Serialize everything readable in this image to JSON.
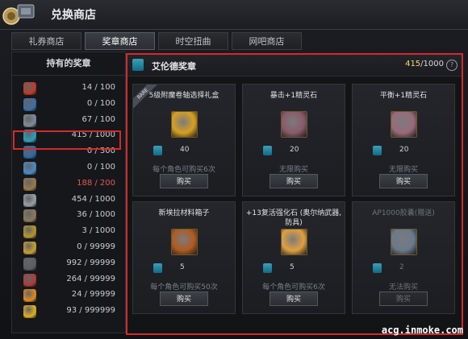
{
  "window": {
    "title": "兑换商店"
  },
  "tabs": [
    {
      "label": "礼券商店",
      "active": false
    },
    {
      "label": "奖章商店",
      "active": true
    },
    {
      "label": "时空扭曲",
      "active": false
    },
    {
      "label": "网吧商店",
      "active": false
    }
  ],
  "medals": {
    "header": "持有的奖章",
    "items": [
      {
        "count": "14 / 100",
        "icon": "red-orb-medal-icon",
        "color": "#c0392b"
      },
      {
        "count": "0 / 100",
        "icon": "blue-wing-medal-icon",
        "color": "#3b6fa8"
      },
      {
        "count": "67 / 100",
        "icon": "sword-medal-icon",
        "color": "#7f8c9a"
      },
      {
        "count": "415 / 1000",
        "icon": "elven-medal-icon",
        "color": "#2aa0c0",
        "selected": true
      },
      {
        "count": "0 / 300",
        "icon": "blue-shield-medal-icon",
        "color": "#2a6aa8"
      },
      {
        "count": "0 / 100",
        "icon": "blue-emblem-medal-icon",
        "color": "#4a8ac8"
      },
      {
        "count": "188 / 200",
        "icon": "bronze-medal-icon",
        "color": "#9a7a4a",
        "max": true
      },
      {
        "count": "454 / 1000",
        "icon": "silver-shield-medal-icon",
        "color": "#9aa0a6"
      },
      {
        "count": "36 / 1000",
        "icon": "winged-shield-medal-icon",
        "color": "#8a7a5a"
      },
      {
        "count": "3 / 1000",
        "icon": "gold-crest-medal-icon",
        "color": "#b8962a"
      },
      {
        "count": "0 / 99999",
        "icon": "gold-laurel-medal-icon",
        "color": "#c8a030"
      },
      {
        "count": "992 / 99999",
        "icon": "dark-shield-medal-icon",
        "color": "#5a5e64"
      },
      {
        "count": "264 / 99999",
        "icon": "red-gem-medal-icon",
        "color": "#b03a3a"
      },
      {
        "count": "24 / 99999",
        "icon": "orange-face-medal-icon",
        "color": "#e08a20"
      },
      {
        "count": "93 / 999999",
        "icon": "gold-coin-medal-icon",
        "color": "#e0b020"
      }
    ]
  },
  "selected_medal": {
    "name": "艾伦德奖章",
    "owned": "415",
    "max": "1000",
    "icon": "elven-medal-icon"
  },
  "shop_items": [
    {
      "name": "5级附魔卷轴选择礼盒",
      "price": "40",
      "limit": "每个角色可购买6次",
      "buy": "购买",
      "rare": "RARE",
      "icon": "gift-box-icon",
      "color": "#d8a020",
      "disabled": false
    },
    {
      "name": "暴击+1精灵石",
      "price": "20",
      "limit": "无限购买",
      "buy": "购买",
      "icon": "spirit-stone-icon",
      "color": "#8a5a6a",
      "disabled": false
    },
    {
      "name": "平衡+1精灵石",
      "price": "20",
      "limit": "无限购买",
      "buy": "购买",
      "icon": "spirit-stone-icon",
      "color": "#9a6a7a",
      "disabled": false
    },
    {
      "name": "新埃拉材料箱子",
      "price": "5",
      "limit": "每个角色可购买50次",
      "buy": "购买",
      "icon": "material-box-icon",
      "color": "#b05a20",
      "disabled": false
    },
    {
      "name": "+13复活强化石 (奥尔纳武器, 防具)",
      "price": "5",
      "limit": "每个角色可购买6次",
      "buy": "购买",
      "icon": "revival-stone-icon",
      "color": "#e0a040",
      "disabled": false
    },
    {
      "name": "AP1000胶囊(赠送)",
      "price": "2",
      "limit": "无法购买",
      "buy": "购买",
      "icon": "capsule-icon",
      "color": "#6a7a8a",
      "disabled": true
    }
  ],
  "watermark": "acg.inmoke.com"
}
